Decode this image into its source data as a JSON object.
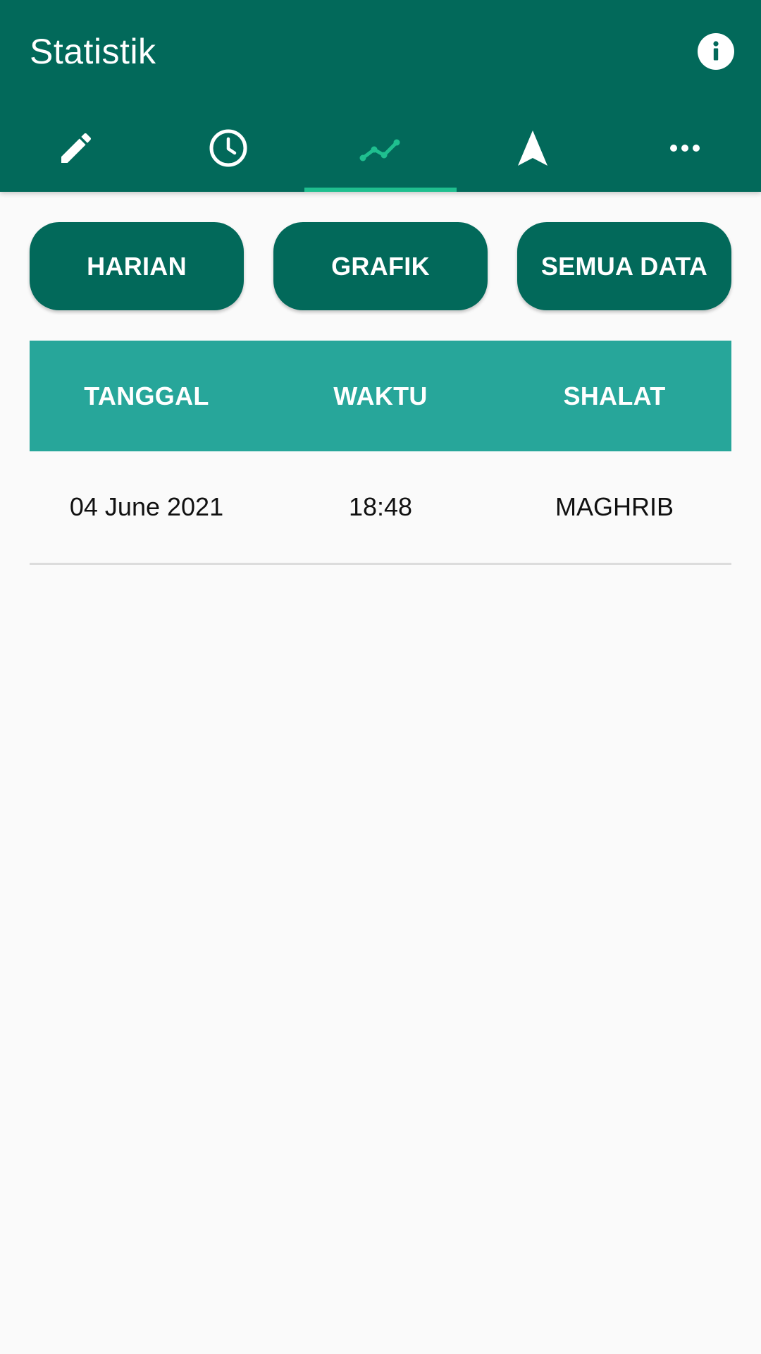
{
  "app_bar": {
    "title": "Statistik",
    "info_icon": "info-icon"
  },
  "tabs": [
    {
      "icon": "pencil-icon",
      "active": false
    },
    {
      "icon": "clock-icon",
      "active": false
    },
    {
      "icon": "line-chart-icon",
      "active": true
    },
    {
      "icon": "navigation-arrow-icon",
      "active": false
    },
    {
      "icon": "more-horizontal-icon",
      "active": false
    }
  ],
  "segments": {
    "harian": "HARIAN",
    "grafik": "GRAFIK",
    "semua_data": "SEMUA DATA"
  },
  "table": {
    "headers": [
      "TANGGAL",
      "WAKTU",
      "SHALAT"
    ],
    "rows": [
      [
        "04 June 2021",
        "18:48",
        "MAGHRIB"
      ]
    ]
  },
  "colors": {
    "primary": "#02695a",
    "header": "#27a69a",
    "accent": "#1fbf8f",
    "background": "#fafafa"
  }
}
